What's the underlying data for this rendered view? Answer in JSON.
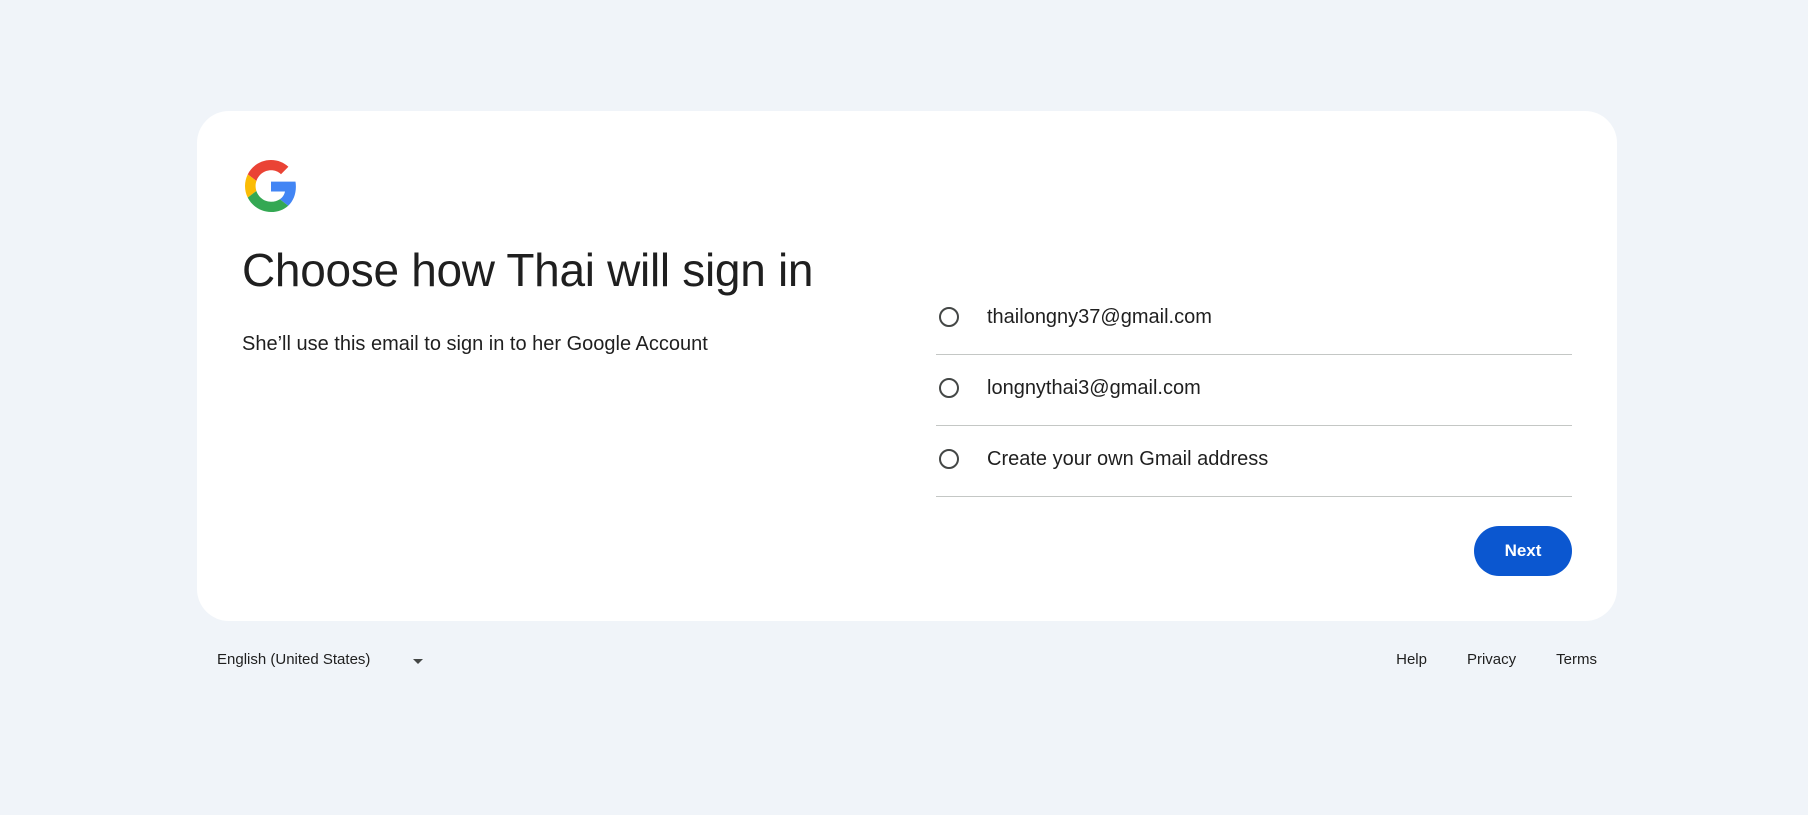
{
  "brand": {
    "logo_icon": "google-g-logo",
    "colors": {
      "blue": "#4285F4",
      "red": "#EA4335",
      "yellow": "#FBBC05",
      "green": "#34A853"
    }
  },
  "page": {
    "title": "Choose how Thai will sign in",
    "subtitle": "She’ll use this email to sign in to her Google Account"
  },
  "options": [
    {
      "label": "thailongny37@gmail.com",
      "selected": false
    },
    {
      "label": "longnythai3@gmail.com",
      "selected": false
    },
    {
      "label": "Create your own Gmail address",
      "selected": false
    }
  ],
  "actions": {
    "next_label": "Next",
    "next_color": "#0b57d0"
  },
  "footer": {
    "language": "English (United States)",
    "language_icon": "chevron-down-icon",
    "links": {
      "help": "Help",
      "privacy": "Privacy",
      "terms": "Terms"
    }
  }
}
